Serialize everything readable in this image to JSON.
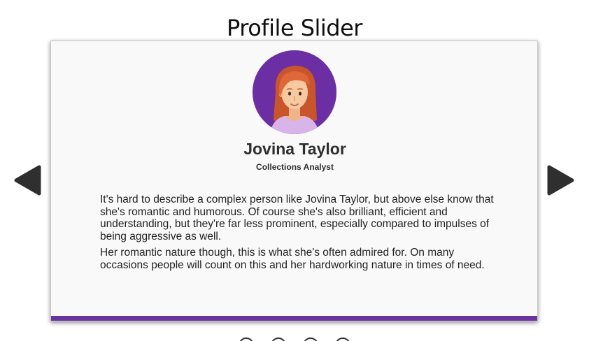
{
  "page": {
    "title": "Profile Slider"
  },
  "profile": {
    "name": "Jovina Taylor",
    "role": "Collections Analyst",
    "avatar_icon": "woman-avatar-icon",
    "bio": [
      "It's hard to describe a complex person like Jovina Taylor, but above else know that she's romantic and humorous. Of course she's also brilliant, efficient and understanding, but they're far less prominent, especially compared to impulses of being aggressive as well.",
      "Her romantic nature though, this is what she's often admired for. On many occasions people will count on this and her hardworking nature in times of need."
    ]
  },
  "controls": {
    "prev_icon": "triangle-left-icon",
    "next_icon": "triangle-right-icon",
    "dot_count": 4
  },
  "colors": {
    "accent": "#6a34a0",
    "avatar_bg": "#6b2fa3",
    "arrow": "#2f2f2f"
  }
}
